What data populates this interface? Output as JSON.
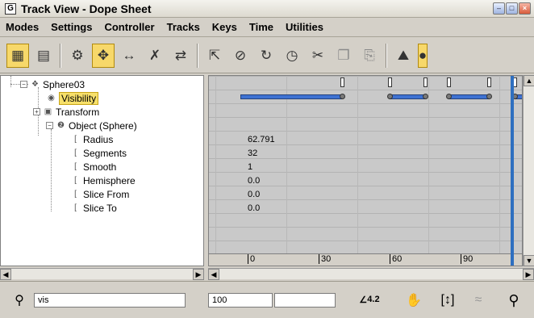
{
  "window": {
    "title": "Track View - Dope Sheet",
    "buttons": [
      "minimize",
      "restore",
      "close"
    ]
  },
  "menu": [
    "Modes",
    "Settings",
    "Controller",
    "Tracks",
    "Keys",
    "Time",
    "Utilities"
  ],
  "toolbar": {
    "icons": [
      "edit-keys-icon",
      "edit-ranges-icon",
      "filters-icon",
      "move-keys-icon",
      "slide-keys-icon",
      "scale-keys-icon",
      "scale-time-icon",
      "select-time-icon",
      "delete-time-icon",
      "reverse-time-icon",
      "insert-time-icon",
      "cut-icon",
      "copy-icon",
      "paste-icon",
      "modify-subtree-icon",
      "lock-icon"
    ],
    "active_icon": "move-keys-icon"
  },
  "tree": {
    "nodes": [
      {
        "label": "Sphere03",
        "icon": "sphere-object-icon",
        "level": 0,
        "expander": "-"
      },
      {
        "label": "Visibility",
        "icon": "visibility-track-icon",
        "level": 1,
        "selected": true
      },
      {
        "label": "Transform",
        "icon": "transform-icon",
        "level": 1,
        "expander": "+"
      },
      {
        "label": "Object (Sphere)",
        "icon": "object-sphere-icon",
        "level": 1,
        "expander": "-"
      },
      {
        "label": "Radius",
        "icon": "param-icon",
        "level": 2
      },
      {
        "label": "Segments",
        "icon": "param-icon",
        "level": 2
      },
      {
        "label": "Smooth",
        "icon": "param-icon",
        "level": 2
      },
      {
        "label": "Hemisphere",
        "icon": "param-icon",
        "level": 2
      },
      {
        "label": "Slice From",
        "icon": "param-icon",
        "level": 2
      },
      {
        "label": "Slice To",
        "icon": "param-icon",
        "level": 2
      }
    ]
  },
  "track": {
    "values": [
      "",
      "",
      "",
      "",
      "62.791",
      "32",
      "1",
      "0.0",
      "0.0",
      "0.0"
    ],
    "ruler_ticks": [
      "0",
      "30",
      "60",
      "90"
    ],
    "visibility_ranges": [
      {
        "from": -3,
        "to": 40
      },
      {
        "from": 60,
        "to": 75
      },
      {
        "from": 85,
        "to": 102
      },
      {
        "from": 113,
        "to": 125
      }
    ],
    "visibility_keys": [
      40,
      60,
      75,
      85,
      102,
      113
    ],
    "current_frame": 112
  },
  "status": {
    "search_value": "vis",
    "frame_field": "100",
    "angle_readout": "4.2",
    "icons": [
      "zoom-selected-object-icon",
      "pan-hand-icon",
      "zoom-horizontal-extents-icon",
      "zoom-value-extents-icon",
      "zoom-icon"
    ]
  }
}
